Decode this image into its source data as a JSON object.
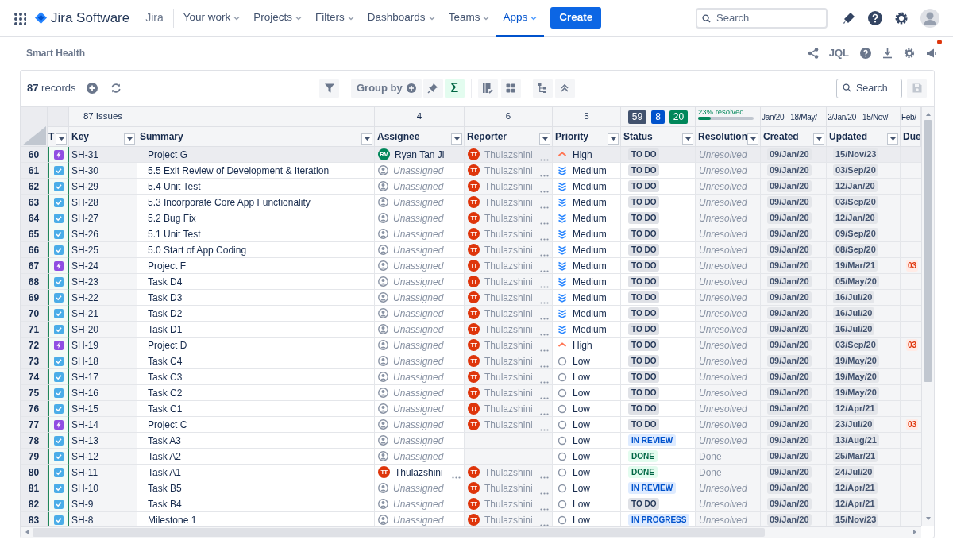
{
  "nav": {
    "product": "Jira Software",
    "app_switch": "Jira",
    "menus": [
      {
        "label": "Your work",
        "selected": false
      },
      {
        "label": "Projects",
        "selected": false
      },
      {
        "label": "Filters",
        "selected": false
      },
      {
        "label": "Dashboards",
        "selected": false
      },
      {
        "label": "Teams",
        "selected": false
      },
      {
        "label": "Apps",
        "selected": true
      }
    ],
    "create": "Create",
    "search": {
      "placeholder": "Search"
    }
  },
  "page": {
    "title": "Smart Health",
    "jql": "JQL",
    "has_notification": true
  },
  "toolbar": {
    "count": "87",
    "count_label": "records",
    "group_by": "Group by",
    "sum_symbol": "Σ",
    "sum_selected": true,
    "search": {
      "placeholder": "Search"
    }
  },
  "table": {
    "group_row": {
      "key": "87 Issues",
      "assignee": "4",
      "reporter": "6",
      "priority": "5",
      "status_counts": [
        {
          "value": "59",
          "color": "#42526e"
        },
        {
          "value": "8",
          "color": "#0052cc"
        },
        {
          "value": "20",
          "color": "#00875a"
        }
      ],
      "resolved": {
        "label": "23% resolved",
        "level": 0.23
      },
      "created": "Jan/20 - 18/May/",
      "updated": "2/Jan/20 - 15/Nov/",
      "due": "Feb/"
    },
    "columns": [
      {
        "label": "T"
      },
      {
        "label": "Key"
      },
      {
        "label": "Summary"
      },
      {
        "label": "Assignee"
      },
      {
        "label": "Reporter"
      },
      {
        "label": "Priority"
      },
      {
        "label": "Status"
      },
      {
        "label": "Resolution"
      },
      {
        "label": "Created"
      },
      {
        "label": "Updated"
      },
      {
        "label": "Due"
      }
    ],
    "rows": [
      {
        "num": "60",
        "kind": "epic",
        "key": "SH-31",
        "summary": "Project G",
        "assignee": {
          "kind": "user",
          "name": "Ryan Tan Ji",
          "initials": "RM",
          "color": "#00875a"
        },
        "reporter": {
          "name": "Thulazshini",
          "initials": "TT"
        },
        "priority": {
          "kind": "high",
          "label": "High"
        },
        "status": {
          "kind": "todo",
          "label": "TO DO"
        },
        "resolution": "Unresolved",
        "resolved": false,
        "created": "09/Jan/20",
        "updated": "15/Nov/23",
        "hovered": true
      },
      {
        "num": "61",
        "kind": "task",
        "key": "SH-30",
        "summary": "5.5 Exit Review of Development & Iteration",
        "assignee": {
          "kind": "unassigned",
          "name": "Unassigned"
        },
        "reporter": {
          "name": "Thulazshini",
          "initials": "TT"
        },
        "priority": {
          "kind": "medium",
          "label": "Medium"
        },
        "status": {
          "kind": "todo",
          "label": "TO DO"
        },
        "resolution": "Unresolved",
        "resolved": false,
        "created": "09/Jan/20",
        "updated": "03/Sep/20",
        "hovered": false
      },
      {
        "num": "62",
        "kind": "task",
        "key": "SH-29",
        "summary": "5.4 Unit Test",
        "assignee": {
          "kind": "unassigned",
          "name": "Unassigned"
        },
        "reporter": {
          "name": "Thulazshini",
          "initials": "TT"
        },
        "priority": {
          "kind": "medium",
          "label": "Medium"
        },
        "status": {
          "kind": "todo",
          "label": "TO DO"
        },
        "resolution": "Unresolved",
        "resolved": false,
        "created": "09/Jan/20",
        "updated": "12/Jan/20",
        "hovered": false
      },
      {
        "num": "63",
        "kind": "task",
        "key": "SH-28",
        "summary": "5.3 Incorporate Core App Functionality",
        "assignee": {
          "kind": "unassigned",
          "name": "Unassigned"
        },
        "reporter": {
          "name": "Thulazshini",
          "initials": "TT"
        },
        "priority": {
          "kind": "medium",
          "label": "Medium"
        },
        "status": {
          "kind": "todo",
          "label": "TO DO"
        },
        "resolution": "Unresolved",
        "resolved": false,
        "created": "09/Jan/20",
        "updated": "03/Sep/20",
        "hovered": false
      },
      {
        "num": "64",
        "kind": "task",
        "key": "SH-27",
        "summary": "5.2 Bug Fix",
        "assignee": {
          "kind": "unassigned",
          "name": "Unassigned"
        },
        "reporter": {
          "name": "Thulazshini",
          "initials": "TT"
        },
        "priority": {
          "kind": "medium",
          "label": "Medium"
        },
        "status": {
          "kind": "todo",
          "label": "TO DO"
        },
        "resolution": "Unresolved",
        "resolved": false,
        "created": "09/Jan/20",
        "updated": "12/Jan/20",
        "hovered": false
      },
      {
        "num": "65",
        "kind": "task",
        "key": "SH-26",
        "summary": "5.1 Unit Test",
        "assignee": {
          "kind": "unassigned",
          "name": "Unassigned"
        },
        "reporter": {
          "name": "Thulazshini",
          "initials": "TT"
        },
        "priority": {
          "kind": "medium",
          "label": "Medium"
        },
        "status": {
          "kind": "todo",
          "label": "TO DO"
        },
        "resolution": "Unresolved",
        "resolved": false,
        "created": "09/Jan/20",
        "updated": "09/Sep/20",
        "hovered": false
      },
      {
        "num": "66",
        "kind": "task",
        "key": "SH-25",
        "summary": "5.0 Start of App Coding",
        "assignee": {
          "kind": "unassigned",
          "name": "Unassigned"
        },
        "reporter": {
          "name": "Thulazshini",
          "initials": "TT"
        },
        "priority": {
          "kind": "medium",
          "label": "Medium"
        },
        "status": {
          "kind": "todo",
          "label": "TO DO"
        },
        "resolution": "Unresolved",
        "resolved": false,
        "created": "09/Jan/20",
        "updated": "08/Sep/20",
        "hovered": false
      },
      {
        "num": "67",
        "kind": "epic",
        "key": "SH-24",
        "summary": "Project F",
        "assignee": {
          "kind": "unassigned",
          "name": "Unassigned"
        },
        "reporter": {
          "name": "Thulazshini",
          "initials": "TT"
        },
        "priority": {
          "kind": "medium",
          "label": "Medium"
        },
        "status": {
          "kind": "todo",
          "label": "TO DO"
        },
        "resolution": "Unresolved",
        "resolved": false,
        "created": "09/Jan/20",
        "updated": "19/Mar/21",
        "due": "03",
        "hovered": false
      },
      {
        "num": "68",
        "kind": "task",
        "key": "SH-23",
        "summary": "Task D4",
        "assignee": {
          "kind": "unassigned",
          "name": "Unassigned"
        },
        "reporter": {
          "name": "Thulazshini",
          "initials": "TT"
        },
        "priority": {
          "kind": "medium",
          "label": "Medium"
        },
        "status": {
          "kind": "todo",
          "label": "TO DO"
        },
        "resolution": "Unresolved",
        "resolved": false,
        "created": "09/Jan/20",
        "updated": "05/May/20",
        "hovered": false
      },
      {
        "num": "69",
        "kind": "task",
        "key": "SH-22",
        "summary": "Task D3",
        "assignee": {
          "kind": "unassigned",
          "name": "Unassigned"
        },
        "reporter": {
          "name": "Thulazshini",
          "initials": "TT"
        },
        "priority": {
          "kind": "medium",
          "label": "Medium"
        },
        "status": {
          "kind": "todo",
          "label": "TO DO"
        },
        "resolution": "Unresolved",
        "resolved": false,
        "created": "09/Jan/20",
        "updated": "16/Jul/20",
        "hovered": false
      },
      {
        "num": "70",
        "kind": "task",
        "key": "SH-21",
        "summary": "Task D2",
        "assignee": {
          "kind": "unassigned",
          "name": "Unassigned"
        },
        "reporter": {
          "name": "Thulazshini",
          "initials": "TT"
        },
        "priority": {
          "kind": "medium",
          "label": "Medium"
        },
        "status": {
          "kind": "todo",
          "label": "TO DO"
        },
        "resolution": "Unresolved",
        "resolved": false,
        "created": "09/Jan/20",
        "updated": "16/Jul/20",
        "hovered": false
      },
      {
        "num": "71",
        "kind": "task",
        "key": "SH-20",
        "summary": "Task D1",
        "assignee": {
          "kind": "unassigned",
          "name": "Unassigned"
        },
        "reporter": {
          "name": "Thulazshini",
          "initials": "TT"
        },
        "priority": {
          "kind": "medium",
          "label": "Medium"
        },
        "status": {
          "kind": "todo",
          "label": "TO DO"
        },
        "resolution": "Unresolved",
        "resolved": false,
        "created": "09/Jan/20",
        "updated": "16/Jul/20",
        "hovered": false
      },
      {
        "num": "72",
        "kind": "epic",
        "key": "SH-19",
        "summary": "Project D",
        "assignee": {
          "kind": "unassigned",
          "name": "Unassigned"
        },
        "reporter": {
          "name": "Thulazshini",
          "initials": "TT"
        },
        "priority": {
          "kind": "high",
          "label": "High"
        },
        "status": {
          "kind": "todo",
          "label": "TO DO"
        },
        "resolution": "Unresolved",
        "resolved": false,
        "created": "09/Jan/20",
        "updated": "03/Sep/20",
        "due": "03",
        "hovered": false
      },
      {
        "num": "73",
        "kind": "task",
        "key": "SH-18",
        "summary": "Task C4",
        "assignee": {
          "kind": "unassigned",
          "name": "Unassigned"
        },
        "reporter": {
          "name": "Thulazshini",
          "initials": "TT"
        },
        "priority": {
          "kind": "low",
          "label": "Low"
        },
        "status": {
          "kind": "todo",
          "label": "TO DO"
        },
        "resolution": "Unresolved",
        "resolved": false,
        "created": "09/Jan/20",
        "updated": "19/May/20",
        "hovered": false
      },
      {
        "num": "74",
        "kind": "task",
        "key": "SH-17",
        "summary": "Task C3",
        "assignee": {
          "kind": "unassigned",
          "name": "Unassigned"
        },
        "reporter": {
          "name": "Thulazshini",
          "initials": "TT"
        },
        "priority": {
          "kind": "low",
          "label": "Low"
        },
        "status": {
          "kind": "todo",
          "label": "TO DO"
        },
        "resolution": "Unresolved",
        "resolved": false,
        "created": "09/Jan/20",
        "updated": "19/May/20",
        "hovered": false
      },
      {
        "num": "75",
        "kind": "task",
        "key": "SH-16",
        "summary": "Task C2",
        "assignee": {
          "kind": "unassigned",
          "name": "Unassigned"
        },
        "reporter": {
          "name": "Thulazshini",
          "initials": "TT"
        },
        "priority": {
          "kind": "low",
          "label": "Low"
        },
        "status": {
          "kind": "todo",
          "label": "TO DO"
        },
        "resolution": "Unresolved",
        "resolved": false,
        "created": "09/Jan/20",
        "updated": "19/May/20",
        "hovered": false
      },
      {
        "num": "76",
        "kind": "task",
        "key": "SH-15",
        "summary": "Task C1",
        "assignee": {
          "kind": "unassigned",
          "name": "Unassigned"
        },
        "reporter": {
          "name": "Thulazshini",
          "initials": "TT"
        },
        "priority": {
          "kind": "low",
          "label": "Low"
        },
        "status": {
          "kind": "todo",
          "label": "TO DO"
        },
        "resolution": "Unresolved",
        "resolved": false,
        "created": "09/Jan/20",
        "updated": "12/Apr/21",
        "hovered": false
      },
      {
        "num": "77",
        "kind": "epic",
        "key": "SH-14",
        "summary": "Project C",
        "assignee": {
          "kind": "unassigned",
          "name": "Unassigned"
        },
        "reporter": {
          "name": "Thulazshini",
          "initials": "TT"
        },
        "priority": {
          "kind": "low",
          "label": "Low"
        },
        "status": {
          "kind": "todo",
          "label": "TO DO"
        },
        "resolution": "Unresolved",
        "resolved": false,
        "created": "09/Jan/20",
        "updated": "23/Jul/20",
        "due": "03",
        "hovered": false
      },
      {
        "num": "78",
        "kind": "task",
        "key": "SH-13",
        "summary": "Task A3",
        "assignee": {
          "kind": "unassigned",
          "name": "Unassigned"
        },
        "priority": {
          "kind": "low",
          "label": "Low"
        },
        "status": {
          "kind": "review",
          "label": "IN REVIEW"
        },
        "resolution": "Unresolved",
        "resolved": false,
        "created": "09/Jan/20",
        "updated": "13/Aug/21",
        "hovered": false
      },
      {
        "num": "79",
        "kind": "task",
        "key": "SH-12",
        "summary": "Task A2",
        "assignee": {
          "kind": "unassigned",
          "name": "Unassigned"
        },
        "priority": {
          "kind": "low",
          "label": "Low"
        },
        "status": {
          "kind": "done",
          "label": "DONE"
        },
        "resolution": "Done",
        "resolved": true,
        "created": "09/Jan/20",
        "updated": "25/Mar/21",
        "hovered": false
      },
      {
        "num": "80",
        "kind": "task",
        "key": "SH-11",
        "summary": "Task A1",
        "assignee": {
          "kind": "user",
          "name": "Thulazshini",
          "initials": "TT",
          "color": "#de350b"
        },
        "reporter": {
          "name": "Thulazshini",
          "initials": "TT"
        },
        "priority": {
          "kind": "low",
          "label": "Low"
        },
        "status": {
          "kind": "done",
          "label": "DONE"
        },
        "resolution": "Done",
        "resolved": true,
        "created": "09/Jan/20",
        "updated": "24/Jul/20",
        "hovered": false
      },
      {
        "num": "81",
        "kind": "task",
        "key": "SH-10",
        "summary": "Task B5",
        "assignee": {
          "kind": "unassigned",
          "name": "Unassigned"
        },
        "reporter": {
          "name": "Thulazshini",
          "initials": "TT"
        },
        "priority": {
          "kind": "low",
          "label": "Low"
        },
        "status": {
          "kind": "review",
          "label": "IN REVIEW"
        },
        "resolution": "Unresolved",
        "resolved": false,
        "created": "09/Jan/20",
        "updated": "12/Apr/21",
        "hovered": false
      },
      {
        "num": "82",
        "kind": "task",
        "key": "SH-9",
        "summary": "Task B4",
        "assignee": {
          "kind": "unassigned",
          "name": "Unassigned"
        },
        "reporter": {
          "name": "Thulazshini",
          "initials": "TT"
        },
        "priority": {
          "kind": "low",
          "label": "Low"
        },
        "status": {
          "kind": "todo",
          "label": "TO DO"
        },
        "resolution": "Unresolved",
        "resolved": false,
        "created": "09/Jan/20",
        "updated": "12/Apr/21",
        "hovered": false
      },
      {
        "num": "83",
        "kind": "task",
        "key": "SH-8",
        "summary": "Milestone 1",
        "assignee": {
          "kind": "unassigned",
          "name": "Unassigned"
        },
        "reporter": {
          "name": "Thulazshini",
          "initials": "TT"
        },
        "priority": {
          "kind": "low",
          "label": "Low"
        },
        "status": {
          "kind": "progress",
          "label": "IN PROGRESS"
        },
        "resolution": "Unresolved",
        "resolved": false,
        "created": "09/Jan/20",
        "updated": "15/Nov/23",
        "hovered": false
      }
    ]
  }
}
